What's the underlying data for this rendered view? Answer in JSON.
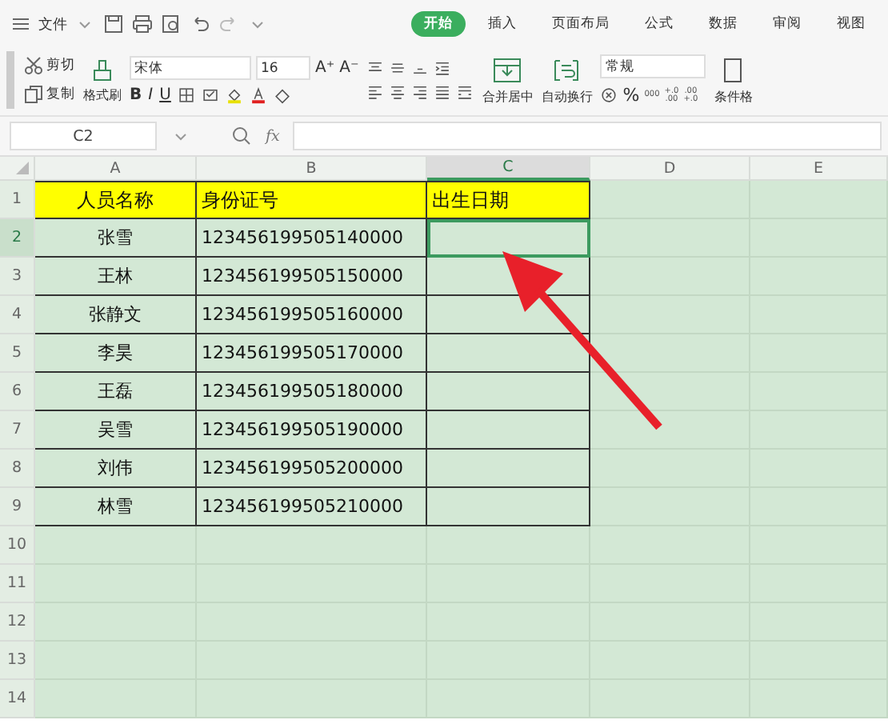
{
  "menu": {
    "file_label": "文件",
    "tabs": [
      {
        "label": "开始",
        "selected": true
      },
      {
        "label": "插入",
        "selected": false
      },
      {
        "label": "页面布局",
        "selected": false
      },
      {
        "label": "公式",
        "selected": false
      },
      {
        "label": "数据",
        "selected": false
      },
      {
        "label": "审阅",
        "selected": false
      },
      {
        "label": "视图",
        "selected": false
      }
    ]
  },
  "ribbon": {
    "cut": "剪切",
    "copy": "复制",
    "format_painter": "格式刷",
    "font": "宋体",
    "font_size": "16",
    "grow_font": "A⁺",
    "shrink_font": "A⁻",
    "bold": "B",
    "italic": "I",
    "underline": "U",
    "merge": "合并居中",
    "wrap": "自动换行",
    "number_format": "常规",
    "percent": "%",
    "thousands": "000",
    "increase_decimal": "+.0 .00",
    "decrease_decimal": ".00 +.0",
    "conditional": "条件格"
  },
  "formula_bar": {
    "cell_name": "C2",
    "fx": "fx"
  },
  "sheet": {
    "columns": [
      {
        "label": "A",
        "selected": false
      },
      {
        "label": "B",
        "selected": false
      },
      {
        "label": "C",
        "selected": true
      },
      {
        "label": "D",
        "selected": false
      },
      {
        "label": "E",
        "selected": false
      }
    ],
    "rows": [
      {
        "number": "1",
        "selected": false,
        "cells": [
          {
            "kind": "header",
            "text": "人员名称"
          },
          {
            "kind": "header",
            "text": "身份证号"
          },
          {
            "kind": "header",
            "text": "出生日期"
          }
        ]
      },
      {
        "number": "2",
        "selected": true,
        "cells": [
          {
            "kind": "data",
            "text": "张雪"
          },
          {
            "kind": "data",
            "text": "123456199505140000"
          },
          {
            "kind": "data",
            "selected": true
          }
        ]
      },
      {
        "number": "3",
        "selected": false,
        "cells": [
          {
            "kind": "data",
            "text": "王林"
          },
          {
            "kind": "data",
            "text": "123456199505150000"
          },
          {
            "kind": "data",
            "selected": false
          }
        ]
      },
      {
        "number": "4",
        "selected": false,
        "cells": [
          {
            "kind": "data",
            "text": "张静文"
          },
          {
            "kind": "data",
            "text": "123456199505160000"
          },
          {
            "kind": "data",
            "selected": false
          }
        ]
      },
      {
        "number": "5",
        "selected": false,
        "cells": [
          {
            "kind": "data",
            "text": "李昊"
          },
          {
            "kind": "data",
            "text": "123456199505170000"
          },
          {
            "kind": "data",
            "selected": false
          }
        ]
      },
      {
        "number": "6",
        "selected": false,
        "cells": [
          {
            "kind": "data",
            "text": "王磊"
          },
          {
            "kind": "data",
            "text": "123456199505180000"
          },
          {
            "kind": "data",
            "selected": false
          }
        ]
      },
      {
        "number": "7",
        "selected": false,
        "cells": [
          {
            "kind": "data",
            "text": "吴雪"
          },
          {
            "kind": "data",
            "text": "123456199505190000"
          },
          {
            "kind": "data",
            "selected": false
          }
        ]
      },
      {
        "number": "8",
        "selected": false,
        "cells": [
          {
            "kind": "data",
            "text": "刘伟"
          },
          {
            "kind": "data",
            "text": "123456199505200000"
          },
          {
            "kind": "data",
            "selected": false
          }
        ]
      },
      {
        "number": "9",
        "selected": false,
        "cells": [
          {
            "kind": "data",
            "text": "林雪"
          },
          {
            "kind": "data",
            "text": "123456199505210000"
          },
          {
            "kind": "data",
            "selected": false
          }
        ]
      },
      {
        "number": "10",
        "selected": false
      },
      {
        "number": "11",
        "selected": false
      },
      {
        "number": "12",
        "selected": false
      },
      {
        "number": "13",
        "selected": false
      },
      {
        "number": "14",
        "selected": false
      }
    ]
  }
}
